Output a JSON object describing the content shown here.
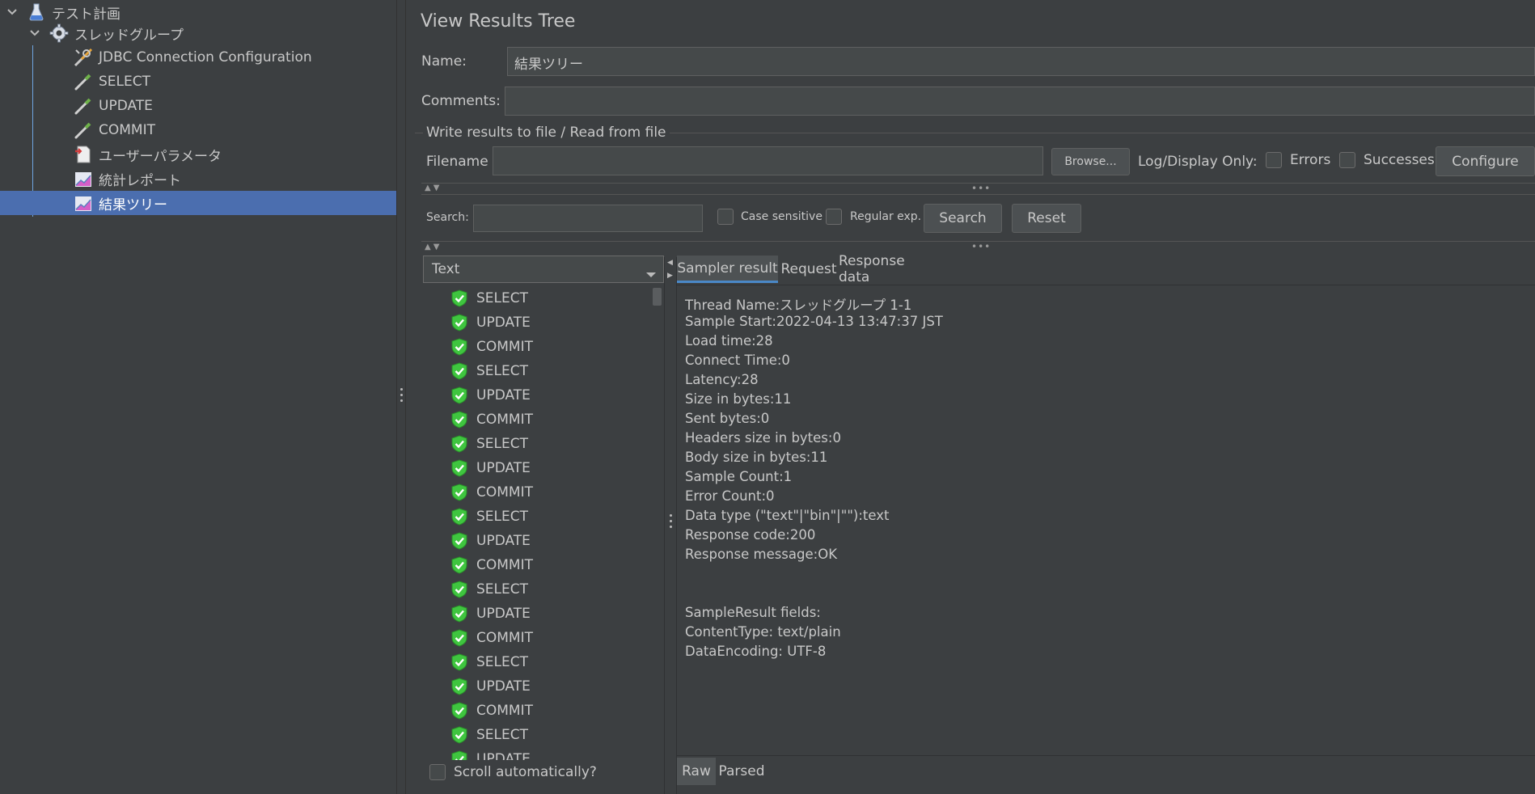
{
  "tree": {
    "items": [
      {
        "label": "テスト計画",
        "icon": "flask-icon"
      },
      {
        "label": "スレッドグループ",
        "icon": "gear-icon"
      },
      {
        "label": "JDBC Connection Configuration",
        "icon": "wrench-icon"
      },
      {
        "label": "SELECT",
        "icon": "pipette-icon"
      },
      {
        "label": "UPDATE",
        "icon": "pipette-icon"
      },
      {
        "label": "COMMIT",
        "icon": "pipette-icon"
      },
      {
        "label": "ユーザーパラメータ",
        "icon": "document-icon"
      },
      {
        "label": "統計レポート",
        "icon": "graph-icon"
      },
      {
        "label": "結果ツリー",
        "icon": "graph-icon"
      }
    ]
  },
  "panel": {
    "title": "View Results Tree",
    "name_label": "Name:",
    "name_value": "結果ツリー",
    "comments_label": "Comments:",
    "comments_value": "",
    "file_group_title": "Write results to file / Read from file",
    "filename_label": "Filename",
    "filename_value": "",
    "browse_label": "Browse...",
    "log_display_label": "Log/Display Only:",
    "errors_label": "Errors",
    "successes_label": "Successes",
    "configure_label": "Configure"
  },
  "search": {
    "label": "Search:",
    "value": "",
    "case_sensitive_label": "Case sensitive",
    "regex_label": "Regular exp.",
    "search_button": "Search",
    "reset_button": "Reset"
  },
  "renderer": {
    "selected": "Text"
  },
  "results": [
    "SELECT",
    "UPDATE",
    "COMMIT",
    "SELECT",
    "UPDATE",
    "COMMIT",
    "SELECT",
    "UPDATE",
    "COMMIT",
    "SELECT",
    "UPDATE",
    "COMMIT",
    "SELECT",
    "UPDATE",
    "COMMIT",
    "SELECT",
    "UPDATE",
    "COMMIT",
    "SELECT",
    "UPDATE"
  ],
  "scroll_auto_label": "Scroll automatically?",
  "detail": {
    "tabs": [
      "Sampler result",
      "Request",
      "Response data"
    ],
    "active_tab": "Sampler result",
    "lines": [
      "Thread Name:スレッドグループ 1-1",
      "Sample Start:2022-04-13 13:47:37 JST",
      "Load time:28",
      "Connect Time:0",
      "Latency:28",
      "Size in bytes:11",
      "Sent bytes:0",
      "Headers size in bytes:0",
      "Body size in bytes:11",
      "Sample Count:1",
      "Error Count:0",
      "Data type (\"text\"|\"bin\"|\"\"):text",
      "Response code:200",
      "Response message:OK",
      "",
      "",
      "SampleResult fields:",
      "ContentType: text/plain",
      "DataEncoding: UTF-8"
    ],
    "bottom_tabs": [
      "Raw",
      "Parsed"
    ],
    "active_bottom_tab": "Raw"
  },
  "colors": {
    "background": "#3c3f41",
    "selection": "#4b6eaf",
    "success": "#3fc53f"
  }
}
